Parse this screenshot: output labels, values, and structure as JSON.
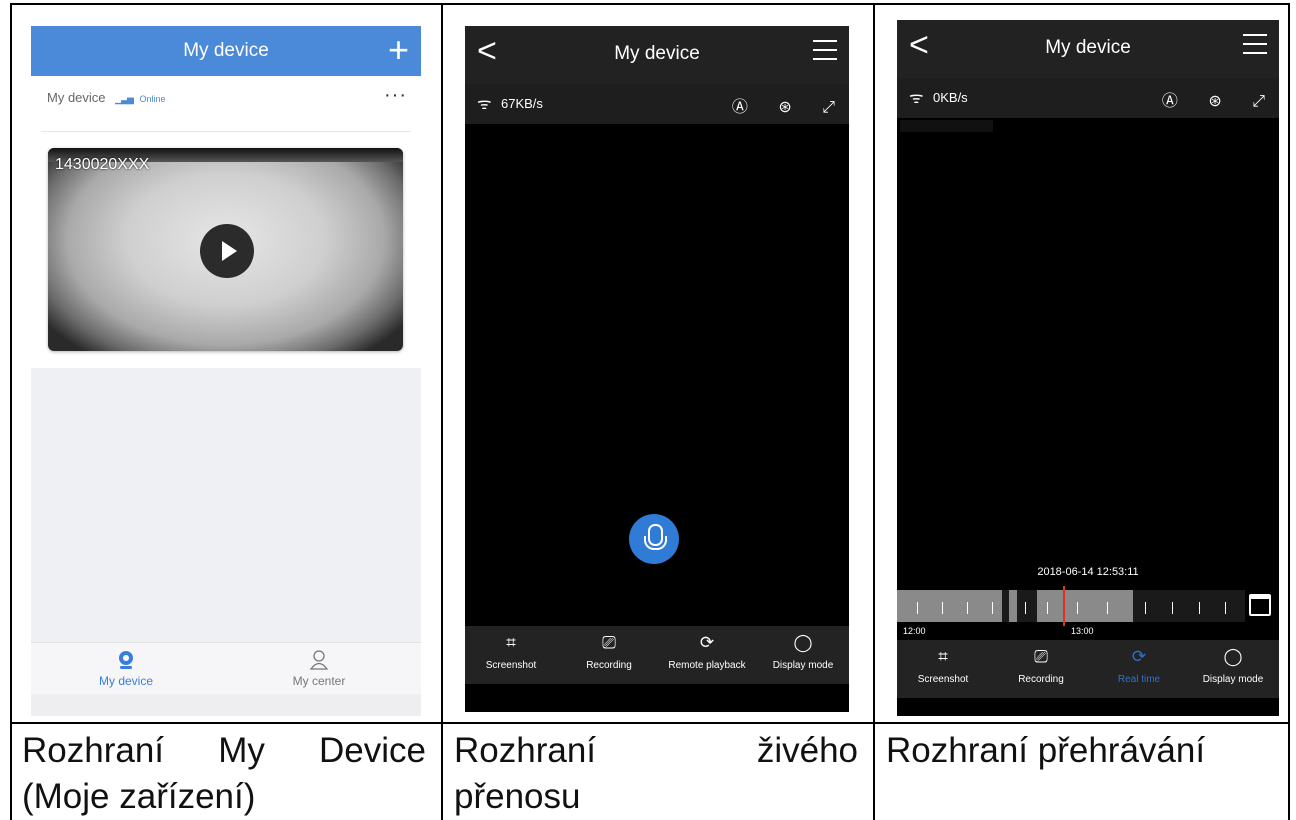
{
  "captions": {
    "c1_line1_words": [
      "Rozhraní",
      "My",
      "Device"
    ],
    "c1_line2": "(Moje zařízení)",
    "c2_line1_words": [
      "Rozhraní",
      "živého"
    ],
    "c2_line2": "přenosu",
    "c3_line1": "Rozhraní přehrávání"
  },
  "panel1": {
    "header_title": "My device",
    "add_glyph": "+",
    "device_name": "My device",
    "signal_glyph": "▁▃▅",
    "status": "Online",
    "more_glyph": "···",
    "camera_id": "1430020XXX",
    "tabs": [
      {
        "label": "My device",
        "icon": "camera-icon",
        "active": true
      },
      {
        "label": "My center",
        "icon": "person-icon",
        "active": false
      }
    ],
    "colors": {
      "accent": "#4a8ad8"
    }
  },
  "panel2": {
    "title": "My device",
    "back_glyph": "<",
    "speed": "67KB/s",
    "tools": [
      {
        "label": "Screenshot",
        "icon": "crop-icon",
        "glyph": "⌗"
      },
      {
        "label": "Recording",
        "icon": "camcorder-icon",
        "glyph": "⎚"
      },
      {
        "label": "Remote playback",
        "icon": "playback-icon",
        "glyph": "⟳"
      },
      {
        "label": "Display mode",
        "icon": "display-mode-icon",
        "glyph": "◯"
      }
    ]
  },
  "panel3": {
    "title": "My device",
    "back_glyph": "<",
    "speed": "0KB/s",
    "timeline_datetime": "2018-06-14 12:53:11",
    "tick_start": "12:00",
    "tick_mid": "13:00",
    "tools": [
      {
        "label": "Screenshot",
        "icon": "crop-icon",
        "glyph": "⌗"
      },
      {
        "label": "Recording",
        "icon": "camcorder-icon",
        "glyph": "⎚"
      },
      {
        "label": "Real time",
        "icon": "realtime-icon",
        "glyph": "⟳",
        "active": true
      },
      {
        "label": "Display mode",
        "icon": "display-mode-icon",
        "glyph": "◯"
      }
    ]
  },
  "status_icons": {
    "wifi": "ᯤ",
    "auto": "Ⓐ",
    "sound": "⊛",
    "fullscreen": "⤢"
  }
}
